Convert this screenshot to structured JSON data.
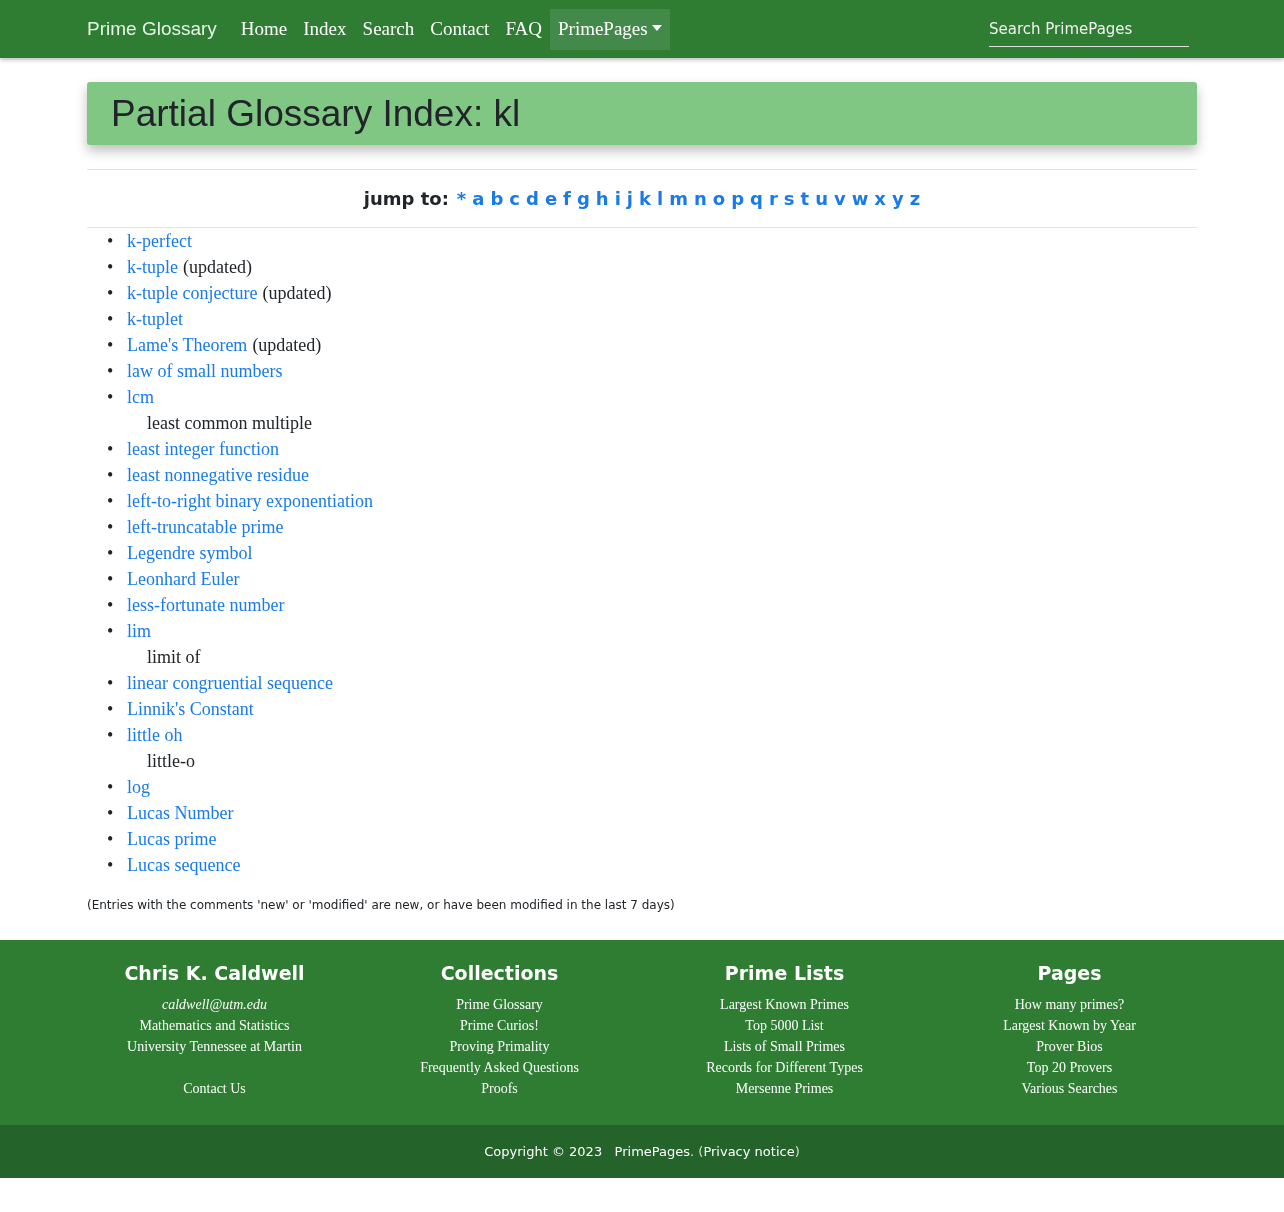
{
  "navbar": {
    "brand": "Prime Glossary",
    "items": [
      {
        "label": "Home",
        "selected": false,
        "dropdown": false
      },
      {
        "label": "Index",
        "selected": false,
        "dropdown": false
      },
      {
        "label": "Search",
        "selected": false,
        "dropdown": false
      },
      {
        "label": "Contact",
        "selected": false,
        "dropdown": false
      },
      {
        "label": "FAQ",
        "selected": false,
        "dropdown": false
      },
      {
        "label": "PrimePages",
        "selected": true,
        "dropdown": true
      }
    ],
    "search": {
      "placeholder": "Search PrimePages"
    }
  },
  "page_title": "Partial Glossary Index: kl",
  "jump": {
    "label": "jump to:",
    "letters": [
      "*",
      "a",
      "b",
      "c",
      "d",
      "e",
      "f",
      "g",
      "h",
      "i",
      "j",
      "k",
      "l",
      "m",
      "n",
      "o",
      "p",
      "q",
      "r",
      "s",
      "t",
      "u",
      "v",
      "w",
      "x",
      "y",
      "z"
    ]
  },
  "bullet": "•",
  "entries": [
    {
      "term": "k-perfect"
    },
    {
      "term": "k-tuple",
      "note": "(updated)"
    },
    {
      "term": "k-tuple conjecture",
      "note": "(updated)"
    },
    {
      "term": "k-tuplet"
    },
    {
      "term": "Lame's Theorem",
      "note": "(updated)"
    },
    {
      "term": "law of small numbers"
    },
    {
      "term": "lcm",
      "description": "least common multiple"
    },
    {
      "term": "least integer function"
    },
    {
      "term": "least nonnegative residue"
    },
    {
      "term": "left-to-right binary exponentiation"
    },
    {
      "term": "left-truncatable prime"
    },
    {
      "term": "Legendre symbol"
    },
    {
      "term": "Leonhard Euler"
    },
    {
      "term": "less-fortunate number"
    },
    {
      "term": "lim",
      "description": "limit of"
    },
    {
      "term": "linear congruential sequence"
    },
    {
      "term": "Linnik's Constant"
    },
    {
      "term": "little oh",
      "description": "little-o"
    },
    {
      "term": "log"
    },
    {
      "term": "Lucas Number"
    },
    {
      "term": "Lucas prime"
    },
    {
      "term": "Lucas sequence"
    }
  ],
  "footnote": "(Entries with the comments 'new' or 'modified' are new, or have been modified in the last 7 days)",
  "footer": {
    "columns": [
      {
        "heading": "Chris K. Caldwell",
        "lines": [
          {
            "text": "caldwell@utm.edu",
            "kind": "email"
          },
          {
            "text": "Mathematics and Statistics",
            "kind": "text"
          },
          {
            "text": "University Tennessee at Martin",
            "kind": "text"
          },
          {
            "text": "Contact Us",
            "kind": "gap-link"
          }
        ]
      },
      {
        "heading": "Collections",
        "lines": [
          {
            "text": "Prime Glossary",
            "kind": "link"
          },
          {
            "text": "Prime Curios!",
            "kind": "link"
          },
          {
            "text": "Proving Primality",
            "kind": "link"
          },
          {
            "text": "Frequently Asked Questions",
            "kind": "link"
          },
          {
            "text": "Proofs",
            "kind": "link"
          }
        ]
      },
      {
        "heading": "Prime Lists",
        "lines": [
          {
            "text": "Largest Known Primes",
            "kind": "link"
          },
          {
            "text": "Top 5000 List",
            "kind": "link"
          },
          {
            "text": "Lists of Small Primes",
            "kind": "link"
          },
          {
            "text": "Records for Different Types",
            "kind": "link"
          },
          {
            "text": "Mersenne Primes",
            "kind": "link"
          }
        ]
      },
      {
        "heading": "Pages",
        "lines": [
          {
            "text": "How many primes?",
            "kind": "link"
          },
          {
            "text": "Largest Known by Year",
            "kind": "link"
          },
          {
            "text": "Prover Bios",
            "kind": "link"
          },
          {
            "text": "Top 20 Provers",
            "kind": "link"
          },
          {
            "text": "Various Searches",
            "kind": "link"
          }
        ]
      }
    ],
    "copyright": {
      "prefix": "Copyright © 2023",
      "site": "PrimePages",
      "middle": ". (",
      "privacy": "Privacy notice",
      "suffix": ")"
    }
  }
}
